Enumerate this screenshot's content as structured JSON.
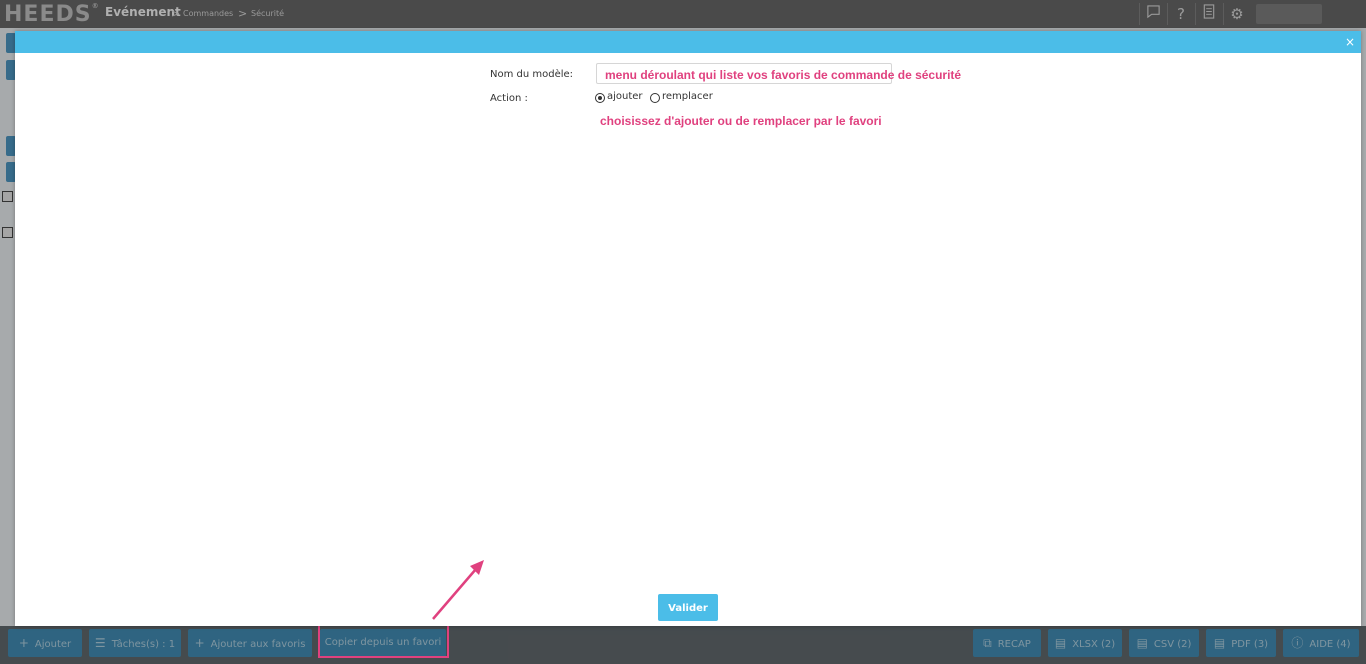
{
  "header": {
    "logo": "HEEDS",
    "logo_mark": "®",
    "breadcrumb": [
      "Evénement",
      "Commandes",
      "Sécurité"
    ],
    "breadcrumb_separator": ">",
    "icons": [
      "chat-icon",
      "help-icon",
      "book-icon",
      "gear-icon"
    ]
  },
  "modal": {
    "close_label": "×",
    "model_label": "Nom du modèle:",
    "action_label": "Action :",
    "radio_options": [
      {
        "label": "ajouter",
        "checked": true
      },
      {
        "label": "remplacer",
        "checked": false
      }
    ],
    "submit_label": "Valider"
  },
  "annotations": {
    "dropdown_note": "menu déroulant qui liste vos favoris de commande de sécurité",
    "action_note": "choisissez d'ajouter ou de remplacer par le favori",
    "highlight_color": "#e0417f"
  },
  "toolbar": {
    "left_buttons": [
      {
        "icon": "+",
        "label": "Ajouter"
      },
      {
        "icon": "☰",
        "label": "Tâches(s) : 1"
      },
      {
        "icon": "+",
        "label": "Ajouter aux favoris"
      },
      {
        "icon": "",
        "label": "Copier depuis un favori"
      }
    ],
    "right_buttons": [
      {
        "icon": "⧉",
        "label": "RECAP"
      },
      {
        "icon": "▤",
        "label": "XLSX (2)"
      },
      {
        "icon": "▤",
        "label": "CSV (2)"
      },
      {
        "icon": "▤",
        "label": "PDF (3)"
      },
      {
        "icon": "ⓘ",
        "label": "AIDE (4)"
      }
    ]
  },
  "colors": {
    "modal_header": "#4bbde8",
    "toolbar_button": "#3f86ac",
    "topbar": "#4a4a4a"
  }
}
